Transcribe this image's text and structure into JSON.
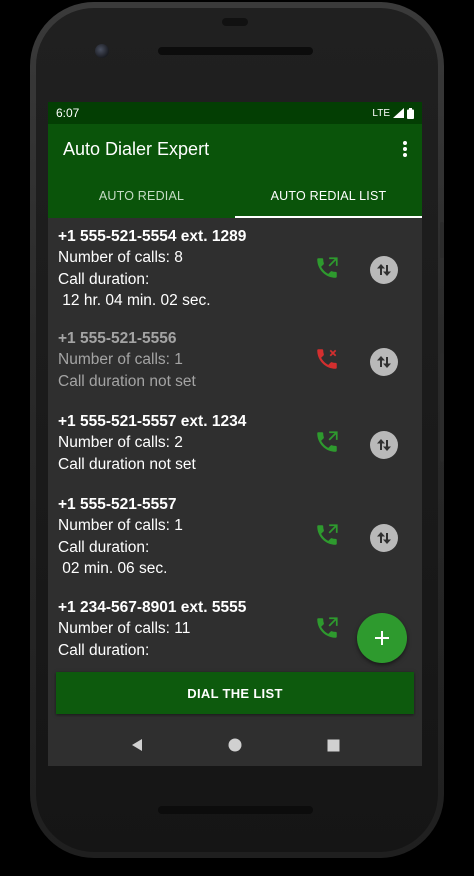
{
  "status_bar": {
    "time": "6:07",
    "network": "LTE"
  },
  "app_bar": {
    "title": "Auto Dialer Expert",
    "menu_icon": "more-vert-icon"
  },
  "tabs": [
    {
      "label": "AUTO REDIAL",
      "active": false
    },
    {
      "label": "AUTO REDIAL LIST",
      "active": true
    }
  ],
  "entries": [
    {
      "number": "+1 555-521-5554 ext. 1289",
      "calls": "Number of calls: 8",
      "duration_label": "Call duration:",
      "duration_value": " 12 hr. 04 min. 02 sec.",
      "enabled": true,
      "call_icon": "call-made-icon",
      "swap_icon": "swap-vert-icon"
    },
    {
      "number": "+1 555-521-5556",
      "calls": "Number of calls: 1",
      "duration_label": "Call duration not set",
      "duration_value": "",
      "enabled": false,
      "call_icon": "call-missed-icon",
      "swap_icon": "swap-vert-icon"
    },
    {
      "number": "+1 555-521-5557 ext. 1234",
      "calls": "Number of calls: 2",
      "duration_label": "Call duration not set",
      "duration_value": "",
      "enabled": true,
      "call_icon": "call-made-icon",
      "swap_icon": "swap-vert-icon"
    },
    {
      "number": "+1 555-521-5557",
      "calls": "Number of calls: 1",
      "duration_label": "Call duration:",
      "duration_value": " 02 min. 06 sec.",
      "enabled": true,
      "call_icon": "call-made-icon",
      "swap_icon": "swap-vert-icon"
    },
    {
      "number": "+1 234-567-8901 ext. 5555",
      "calls": "Number of calls: 11",
      "duration_label": "Call duration:",
      "duration_value": "",
      "enabled": true,
      "call_icon": "call-made-icon",
      "swap_icon": "swap-vert-icon"
    }
  ],
  "fab": {
    "icon": "add-icon"
  },
  "dial_button": {
    "label": "DIAL THE LIST"
  },
  "colors": {
    "primary": "#0a540a",
    "status_bar": "#033e03",
    "accent": "#2e9a2e",
    "call_green": "#2e9a2e",
    "call_red": "#d32f2f"
  }
}
